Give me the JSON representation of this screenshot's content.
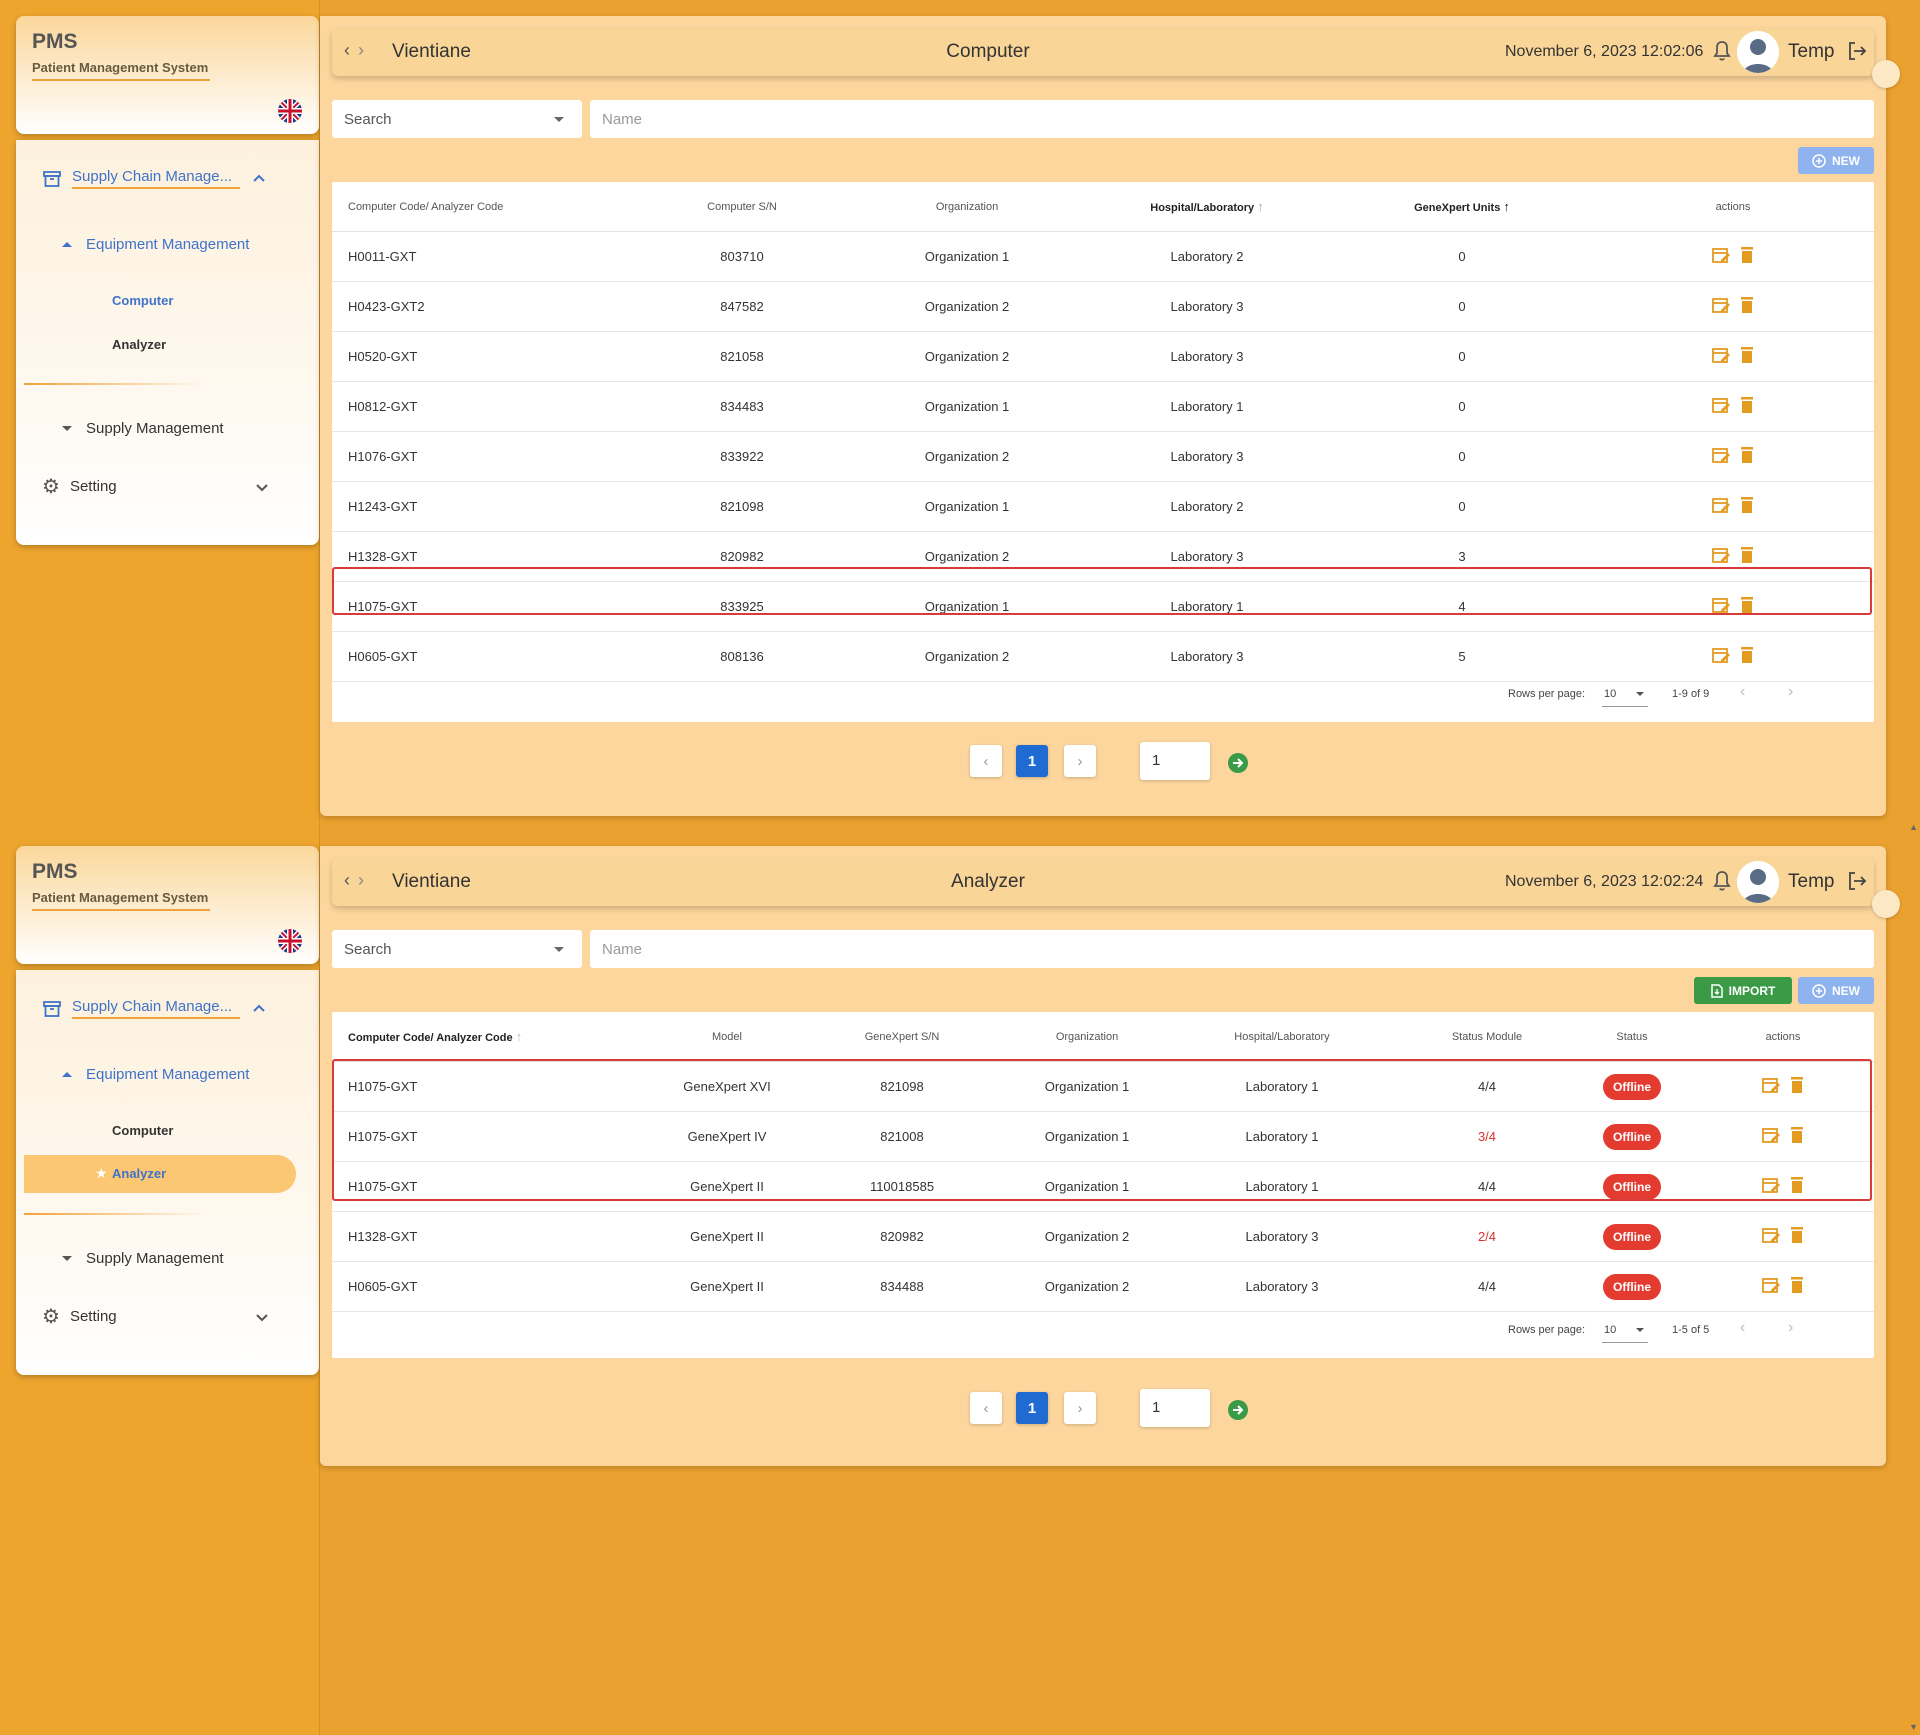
{
  "app": {
    "title": "PMS",
    "subtitle": "Patient Management System"
  },
  "colors": {
    "accent": "#f0a33a",
    "page_bg": "#eaa12f",
    "link_blue": "#3f73c9",
    "offline_red": "#e33b2f",
    "import_green": "#3a9a46",
    "new_blue": "#8fb3ef"
  },
  "sidebar": {
    "scm_label": "Supply Chain Manage...",
    "equipment_label": "Equipment Management",
    "computer_label": "Computer",
    "analyzer_label": "Analyzer",
    "supply_label": "Supply Management",
    "setting_label": "Setting"
  },
  "computer_page": {
    "location": "Vientiane",
    "title": "Computer",
    "datetime": "November 6, 2023 12:02:06",
    "user": "Temp",
    "search_label": "Search",
    "name_placeholder": "Name",
    "new_label": "NEW",
    "columns": [
      "Computer Code/ Analyzer Code",
      "Computer S/N",
      "Organization",
      "Hospital/Laboratory",
      "GeneXpert Units",
      "actions"
    ],
    "rows": [
      [
        "H0011-GXT",
        "803710",
        "Organization 1",
        "Laboratory 2",
        "0"
      ],
      [
        "H0423-GXT2",
        "847582",
        "Organization 2",
        "Laboratory 3",
        "0"
      ],
      [
        "H0520-GXT",
        "821058",
        "Organization 2",
        "Laboratory 3",
        "0"
      ],
      [
        "H0812-GXT",
        "834483",
        "Organization 1",
        "Laboratory 1",
        "0"
      ],
      [
        "H1076-GXT",
        "833922",
        "Organization 2",
        "Laboratory 3",
        "0"
      ],
      [
        "H1243-GXT",
        "821098",
        "Organization 1",
        "Laboratory 2",
        "0"
      ],
      [
        "H1328-GXT",
        "820982",
        "Organization 2",
        "Laboratory 3",
        "3"
      ],
      [
        "H1075-GXT",
        "833925",
        "Organization 1",
        "Laboratory 1",
        "4"
      ],
      [
        "H0605-GXT",
        "808136",
        "Organization 2",
        "Laboratory 3",
        "5"
      ]
    ],
    "rows_per_page_label": "Rows per page:",
    "rows_per_page": "10",
    "range": "1-9 of 9",
    "page": "1",
    "page_input": "1"
  },
  "analyzer_page": {
    "location": "Vientiane",
    "title": "Analyzer",
    "datetime": "November 6, 2023 12:02:24",
    "user": "Temp",
    "search_label": "Search",
    "name_placeholder": "Name",
    "import_label": "IMPORT",
    "new_label": "NEW",
    "columns": [
      "Computer Code/ Analyzer Code",
      "Model",
      "GeneXpert S/N",
      "Organization",
      "Hospital/Laboratory",
      "Status Module",
      "Status",
      "actions"
    ],
    "rows": [
      [
        "H1075-GXT",
        "GeneXpert XVI",
        "821098",
        "Organization 1",
        "Laboratory 1",
        "4/4",
        "Offline"
      ],
      [
        "H1075-GXT",
        "GeneXpert IV",
        "821008",
        "Organization 1",
        "Laboratory 1",
        "3/4",
        "Offline"
      ],
      [
        "H1075-GXT",
        "GeneXpert II",
        "110018585",
        "Organization 1",
        "Laboratory 1",
        "4/4",
        "Offline"
      ],
      [
        "H1328-GXT",
        "GeneXpert II",
        "820982",
        "Organization 2",
        "Laboratory 3",
        "2/4",
        "Offline"
      ],
      [
        "H0605-GXT",
        "GeneXpert II",
        "834488",
        "Organization 2",
        "Laboratory 3",
        "4/4",
        "Offline"
      ]
    ],
    "rows_per_page_label": "Rows per page:",
    "rows_per_page": "10",
    "range": "1-5 of 5",
    "page": "1",
    "page_input": "1"
  }
}
